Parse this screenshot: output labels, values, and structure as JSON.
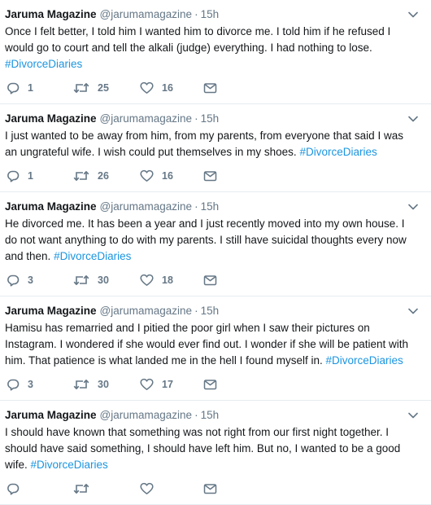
{
  "tweets": [
    {
      "name": "Jaruma Magazine",
      "handle": "@jarumamagazine",
      "time": "15h",
      "text": "Once I felt better, I told him I wanted him to divorce me. I told him if he refused I would go to court and tell the alkali (judge) everything. I had nothing to lose.",
      "hashtag": "#DivorceDiaries",
      "replies": "1",
      "retweets": "25",
      "likes": "16"
    },
    {
      "name": "Jaruma Magazine",
      "handle": "@jarumamagazine",
      "time": "15h",
      "text": "I just wanted to be away from him, from my parents, from everyone that said I was an ungrateful wife. I wish could put themselves in my shoes.",
      "hashtag": "#DivorceDiaries",
      "replies": "1",
      "retweets": "26",
      "likes": "16"
    },
    {
      "name": "Jaruma Magazine",
      "handle": "@jarumamagazine",
      "time": "15h",
      "text": "He divorced me. It has been a year and I just recently moved into my own house. I do not want anything to do with my parents. I still have suicidal thoughts every now and then.",
      "hashtag": "#DivorceDiaries",
      "replies": "3",
      "retweets": "30",
      "likes": "18"
    },
    {
      "name": "Jaruma Magazine",
      "handle": "@jarumamagazine",
      "time": "15h",
      "text": "Hamisu has remarried and I pitied the poor girl when I saw their pictures on Instagram. I wondered if she would ever find out. I wonder if she will be patient with him. That patience is what landed me in the hell I found myself in.",
      "hashtag": "#DivorceDiaries",
      "replies": "3",
      "retweets": "30",
      "likes": "17"
    },
    {
      "name": "Jaruma Magazine",
      "handle": "@jarumamagazine",
      "time": "15h",
      "text": "I should have known that something was not right from our first night together. I should have said something, I should have left him. But no, I wanted to be a good wife.",
      "hashtag": "#DivorceDiaries"
    }
  ],
  "separator": "·",
  "colors": {
    "text": "#14171a",
    "muted": "#657786",
    "link": "#1b95e0"
  },
  "icons": [
    "chevron-down-icon",
    "reply-icon",
    "retweet-icon",
    "like-icon",
    "direct-message-icon"
  ]
}
